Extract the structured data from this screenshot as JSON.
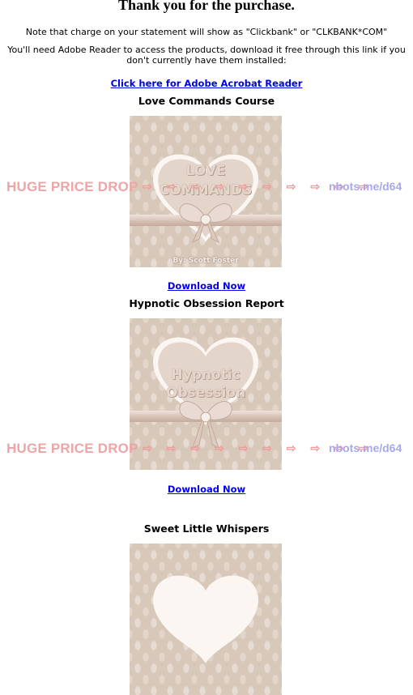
{
  "header": {
    "title": "Thank you for the purchase.",
    "note_statement": "Note that charge on your statement will show as \"Clickbank\" or \"CLKBANK*COM\"",
    "note_reader": "You'll need Adobe Reader to access the products, download it free through this link if you don't currently have them installed:",
    "adobe_link": "Click here for Adobe Acrobat Reader"
  },
  "products": [
    {
      "title": "Love Commands Course",
      "cover_line1": "LOVE",
      "cover_line2": "COMMANDS",
      "cover_byline": "By: Scott Foster",
      "download_label": "Download Now"
    },
    {
      "title": "Hypnotic Obsession Report",
      "cover_line1": "Hypnotic",
      "cover_line2": "Obsession",
      "cover_byline": "",
      "download_label": "Download Now"
    },
    {
      "title": "Sweet Little Whispers",
      "download_label": ""
    }
  ],
  "overlay": {
    "left_text": "HUGE PRICE DROP",
    "arrows": "⇨ ⇨ ⇨ ⇨ ⇨ ⇨ ⇨ ⇨ ⇨ ⇨",
    "right_text": "nbots.me/d64",
    "left_color": "#eea5a5",
    "right_color": "#a8a8ec"
  }
}
